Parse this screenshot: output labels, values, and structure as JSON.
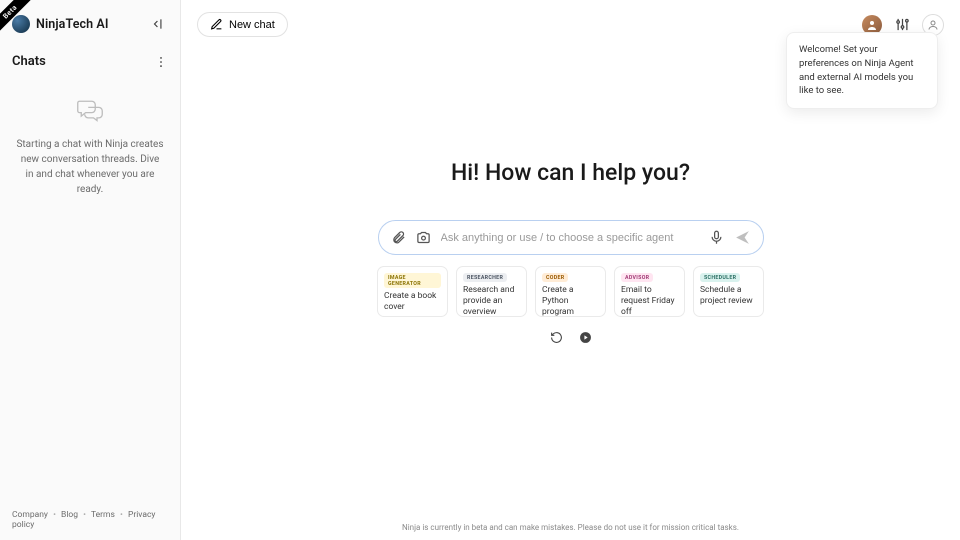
{
  "beta": "Beta",
  "brand": "NinjaTech AI",
  "sidebar": {
    "chats_title": "Chats",
    "empty_text": "Starting a chat with Ninja creates new conversation threads. Dive in and chat whenever you are ready.",
    "footer": {
      "company": "Company",
      "blog": "Blog",
      "terms": "Terms",
      "privacy": "Privacy policy"
    }
  },
  "topbar": {
    "new_chat": "New chat"
  },
  "tooltip": "Welcome! Set your preferences on Ninja Agent and external AI models you like to see.",
  "main": {
    "greeting": "Hi! How can I help you?",
    "placeholder": "Ask anything or use / to choose a specific agent",
    "cards": [
      {
        "tag": "IMAGE GENERATOR",
        "tag_class": "tag-yellow",
        "text": "Create a book cover"
      },
      {
        "tag": "RESEARCHER",
        "tag_class": "tag-gray",
        "text": "Research and provide an overview"
      },
      {
        "tag": "CODER",
        "tag_class": "tag-orange",
        "text": "Create a Python program"
      },
      {
        "tag": "ADVISOR",
        "tag_class": "tag-pink",
        "text": "Email to request Friday off"
      },
      {
        "tag": "SCHEDULER",
        "tag_class": "tag-teal",
        "text": "Schedule a project review"
      }
    ]
  },
  "disclaimer": "Ninja is currently in beta and can make mistakes. Please do not use it for mission critical tasks."
}
